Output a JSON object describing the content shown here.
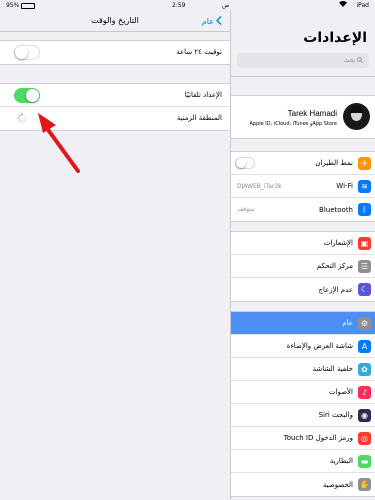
{
  "status": {
    "battery": "95%",
    "time": "2:59",
    "carrier_status": "ص",
    "device": "iPad"
  },
  "detail": {
    "title": "التاريخ والوقت",
    "back_label": "عام",
    "rows": [
      {
        "label": "توقيت ٢٤ ساعة",
        "toggle": false
      },
      {
        "label": "الإعداد تلقائيًا",
        "toggle": true
      },
      {
        "label": "المنطقة الزمنية"
      }
    ]
  },
  "sidebar": {
    "title": "الإعدادات",
    "search_placeholder": "بحث",
    "profile": {
      "name": "Tarek Hamadi",
      "subtitle": "Apple ID، iCloud، iTunes وApp Store"
    },
    "groups": [
      [
        {
          "label": "نمط الطيران",
          "icon": "airplane-icon",
          "color": "#ff9500",
          "glyph": "✈",
          "toggle": false
        },
        {
          "label": "Wi-Fi",
          "icon": "wifi-icon",
          "color": "#007aff",
          "glyph": "≋",
          "value": "DJAWEB_iTar3k"
        },
        {
          "label": "Bluetooth",
          "icon": "bluetooth-icon",
          "color": "#007aff",
          "glyph": "ᛒ",
          "value": "متوقف"
        }
      ],
      [
        {
          "label": "الإشعارات",
          "icon": "notifications-icon",
          "color": "#ff3b30",
          "glyph": "▣"
        },
        {
          "label": "مركز التحكم",
          "icon": "control-center-icon",
          "color": "#8e8e93",
          "glyph": "☰"
        },
        {
          "label": "عدم الإزعاج",
          "icon": "do-not-disturb-icon",
          "color": "#5856d6",
          "glyph": "☾"
        }
      ],
      [
        {
          "label": "عام",
          "icon": "general-gear-icon",
          "color": "#8e8e93",
          "glyph": "⚙",
          "selected": true
        },
        {
          "label": "شاشة العرض والإضاءة",
          "icon": "display-icon",
          "color": "#007aff",
          "glyph": "A"
        },
        {
          "label": "خلفية الشاشة",
          "icon": "wallpaper-icon",
          "color": "#34aadc",
          "glyph": "✿"
        },
        {
          "label": "الأصوات",
          "icon": "sounds-icon",
          "color": "#ff2d55",
          "glyph": "♪"
        },
        {
          "label": "Siri والبحث",
          "icon": "siri-icon",
          "color": "#2c2c54",
          "glyph": "◉"
        },
        {
          "label": "Touch ID ورمز الدخول",
          "icon": "touch-id-icon",
          "color": "#ff3b30",
          "glyph": "◎"
        },
        {
          "label": "البطارية",
          "icon": "battery-icon",
          "color": "#4cd964",
          "glyph": "▬"
        },
        {
          "label": "الخصوصية",
          "icon": "privacy-icon",
          "color": "#8e8e93",
          "glyph": "✋"
        }
      ]
    ]
  },
  "colors": {
    "accent": "#007aff",
    "selected_row": "#4b8ff5",
    "toggle_on": "#4cd964",
    "arrow": "#e0161b"
  }
}
